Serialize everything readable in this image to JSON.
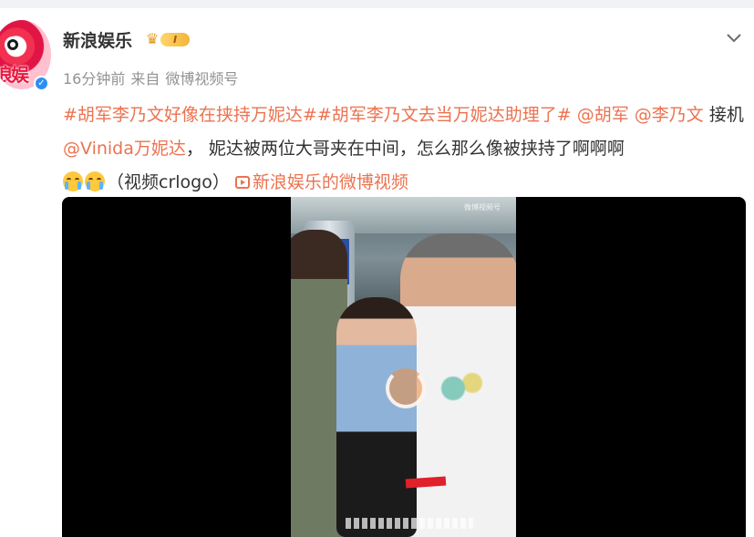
{
  "post": {
    "author": "新浪娱乐",
    "vip_level": "I",
    "time": "16分钟前",
    "source_prefix": "来自",
    "source": "微博视频号",
    "hashtag1": "#胡军李乃文好像在挟持万妮达#",
    "hashtag2": "#胡军李乃文去当万妮达助理了#",
    "mention1": "@胡军",
    "mention2": "@李乃文",
    "text_pickup": " 接机",
    "mention3": "@Vinida万妮达",
    "text_body": "，  妮达被两位大哥夹在中间，怎么那么像被挟持了啊啊啊",
    "text_video_tag": "（视频crlogo）",
    "video_link": "新浪娱乐的微博视频"
  },
  "video": {
    "watermark": "微博视频号"
  },
  "colors": {
    "link": "#eb7350",
    "text": "#333333",
    "meta": "#939393",
    "verified": "#2f8ff0"
  },
  "icons": [
    "chevron-down-icon",
    "verified-icon",
    "crown-icon",
    "crying-emoji-icon",
    "video-link-icon",
    "loading-spinner-icon"
  ]
}
